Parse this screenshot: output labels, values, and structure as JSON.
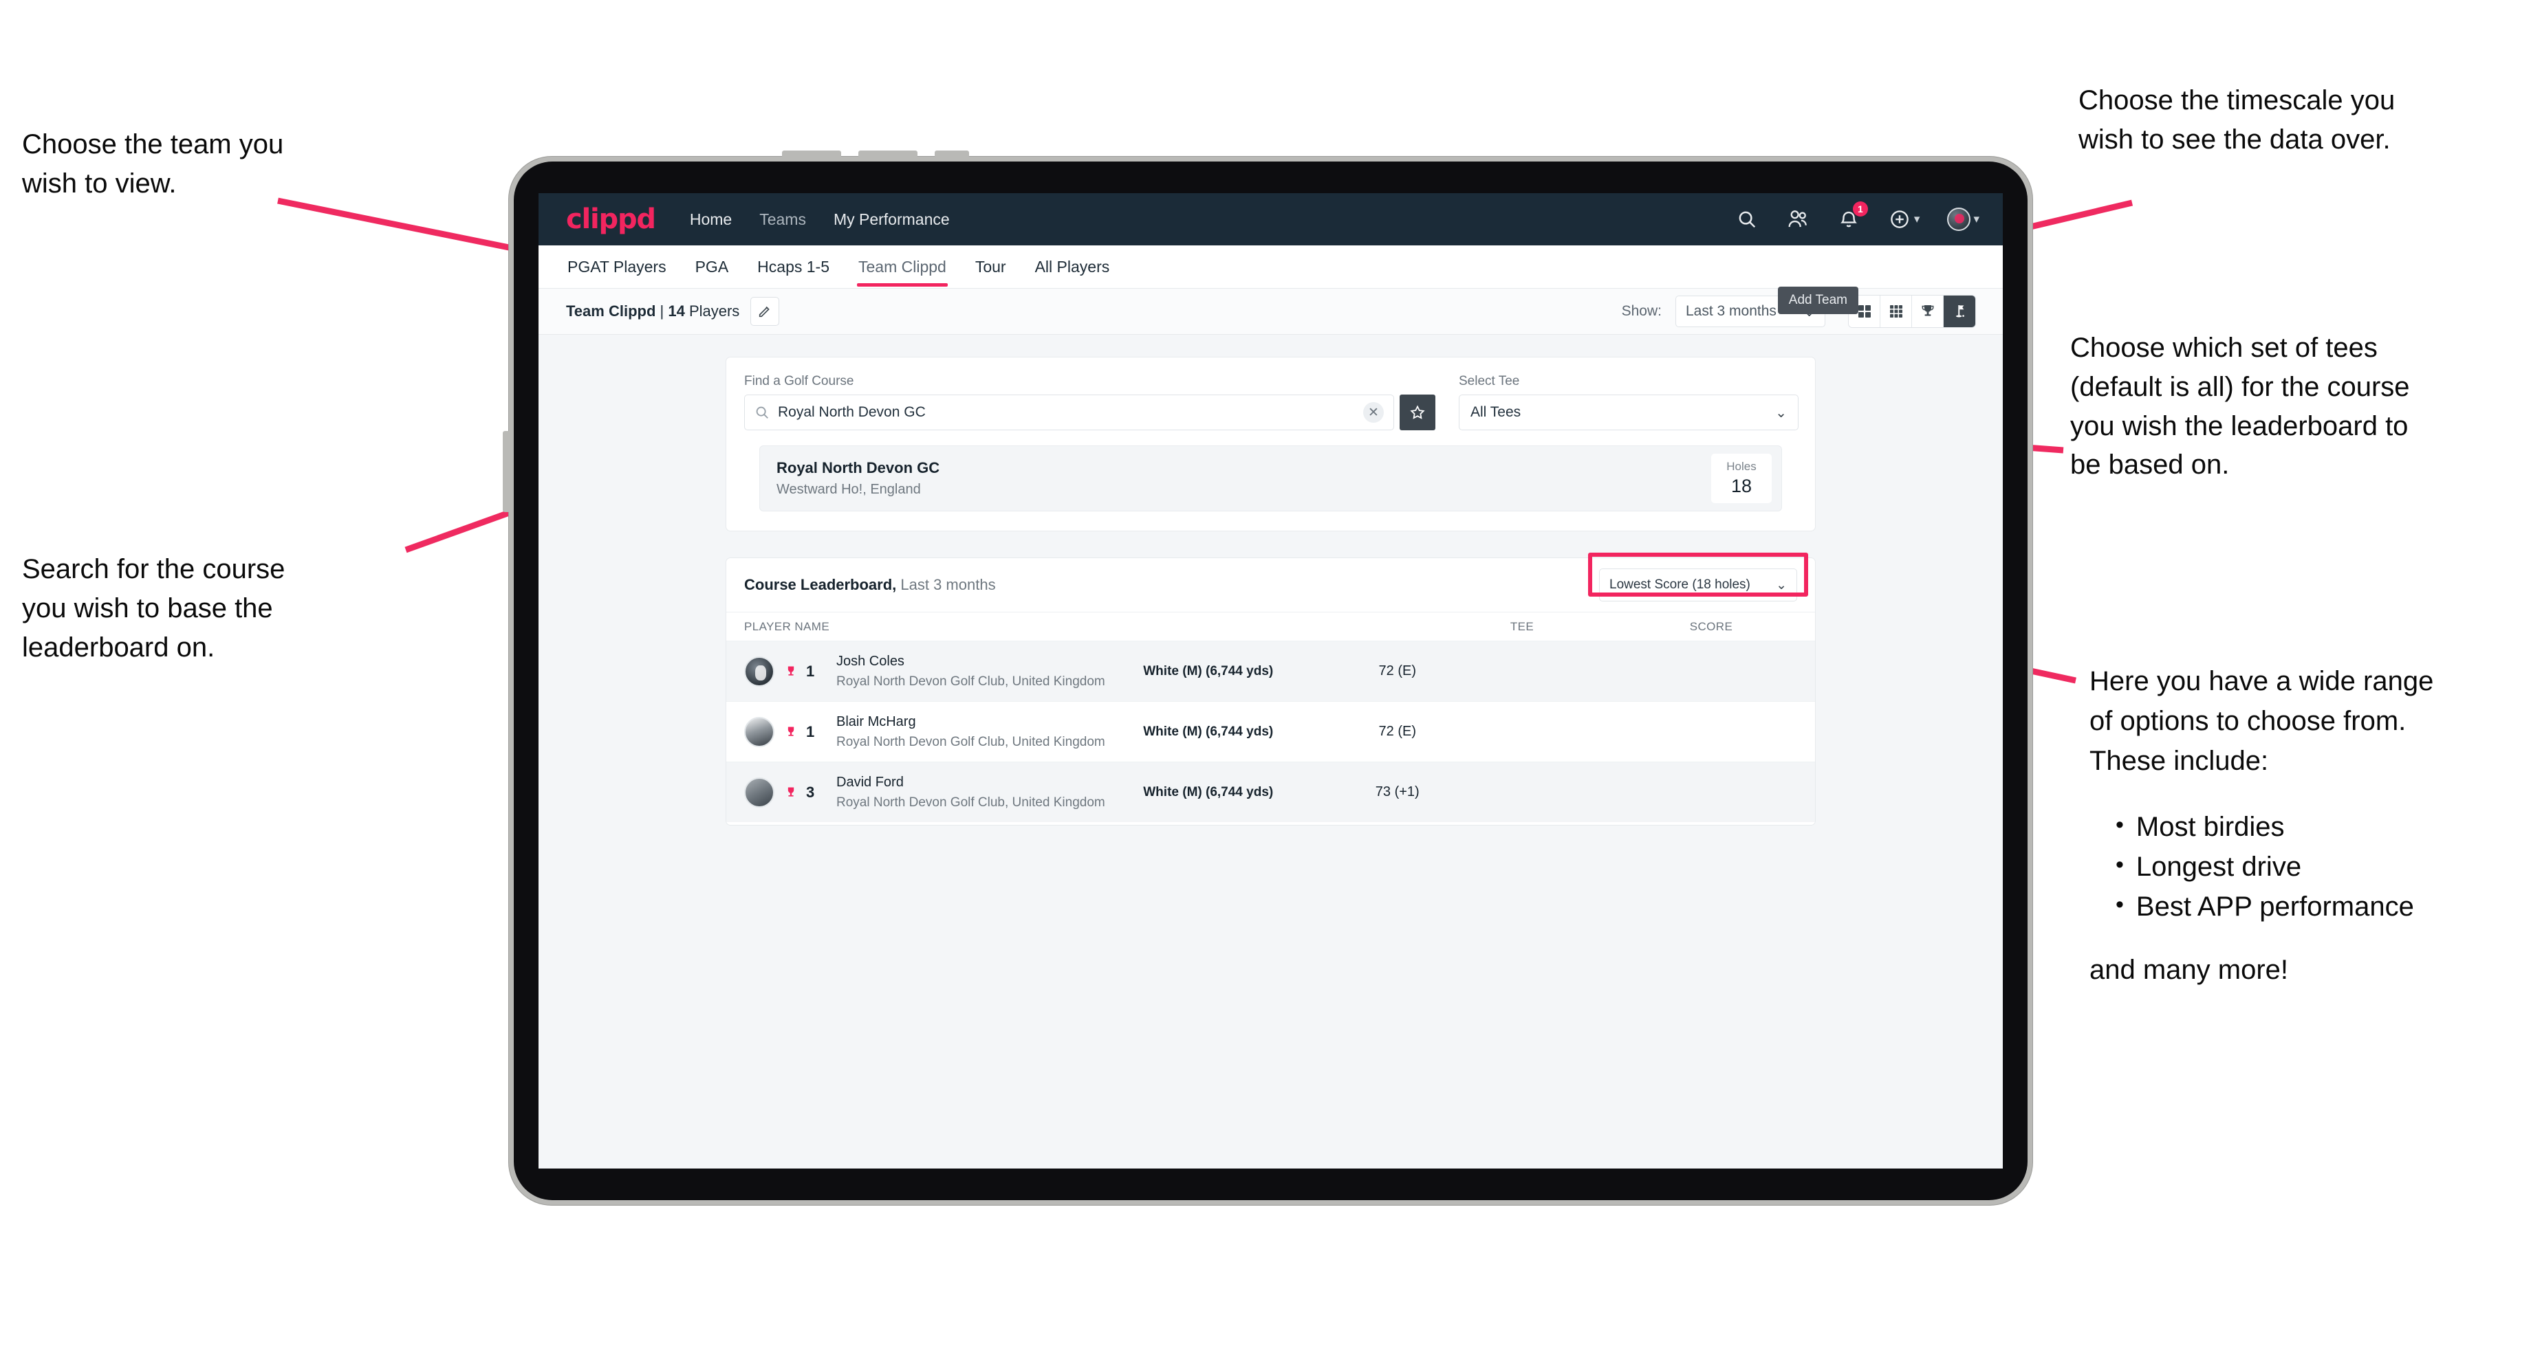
{
  "annotations": {
    "team": "Choose the team you\nwish to view.",
    "search": "Search for the course\nyou wish to base the\nleaderboard on.",
    "timescale": "Choose the timescale you\nwish to see the data over.",
    "tees": "Choose which set of tees\n(default is all) for the course\nyou wish the leaderboard to\nbe based on.",
    "options_intro": "Here you have a wide range\nof options to choose from.\nThese include:",
    "options_bullets": [
      "Most birdies",
      "Longest drive",
      "Best APP performance"
    ],
    "options_outro": "and many more!",
    "arrow_color": "#ef2a60"
  },
  "app": {
    "logo": "clippd",
    "nav": [
      {
        "label": "Home",
        "active": true
      },
      {
        "label": "Teams",
        "active": false
      },
      {
        "label": "My Performance",
        "active": false
      }
    ],
    "header_icons": [
      {
        "name": "search-icon"
      },
      {
        "name": "people-icon"
      },
      {
        "name": "notifications-icon",
        "badge": "1"
      },
      {
        "name": "add-icon"
      },
      {
        "name": "account-avatar"
      }
    ],
    "tooltip": "Add Team",
    "tabs": [
      {
        "label": "PGAT Players",
        "active": false
      },
      {
        "label": "PGA",
        "active": false
      },
      {
        "label": "Hcaps 1-5",
        "active": false
      },
      {
        "label": "Team Clippd",
        "active": true
      },
      {
        "label": "Tour",
        "active": false
      },
      {
        "label": "All Players",
        "active": false
      }
    ],
    "toolbar": {
      "team_name": "Team Clippd",
      "team_separator": " | ",
      "player_count": "14",
      "players_word": " Players",
      "edit_icon": "pencil-icon",
      "show_label": "Show:",
      "show_value": "Last 3 months",
      "view_buttons": [
        {
          "name": "grid-2x2-view",
          "active": false
        },
        {
          "name": "grid-3x3-view",
          "active": false
        },
        {
          "name": "trophy-view",
          "active": false
        },
        {
          "name": "golf-flag-view",
          "active": true
        }
      ]
    },
    "search_panel": {
      "course_label": "Find a Golf Course",
      "course_value": "Royal North Devon GC",
      "course_placeholder": "Find a Golf Course",
      "clear_icon": "close-icon",
      "favourite_icon": "star-icon",
      "tee_label": "Select Tee",
      "tee_value": "All Tees"
    },
    "course_result": {
      "name": "Royal North Devon GC",
      "location": "Westward Ho!, England",
      "holes_label": "Holes",
      "holes_value": "18"
    },
    "leaderboard": {
      "title": "Course Leaderboard,",
      "subtitle": " Last 3 months",
      "sort_value": "Lowest Score (18 holes)",
      "columns": [
        "PLAYER NAME",
        "TEE",
        "SCORE"
      ],
      "rows": [
        {
          "rank": "1",
          "name": "Josh Coles",
          "club": "Royal North Devon Golf Club, United Kingdom",
          "tee": "White (M) (6,744 yds)",
          "score": "72 (E)"
        },
        {
          "rank": "1",
          "name": "Blair McHarg",
          "club": "Royal North Devon Golf Club, United Kingdom",
          "tee": "White (M) (6,744 yds)",
          "score": "72 (E)"
        },
        {
          "rank": "3",
          "name": "David Ford",
          "club": "Royal North Devon Golf Club, United Kingdom",
          "tee": "White (M) (6,744 yds)",
          "score": "73 (+1)"
        }
      ]
    },
    "colors": {
      "brand_pink": "#f2255f",
      "header_navy": "#1b2b38",
      "dark_button": "#3d464e"
    }
  }
}
